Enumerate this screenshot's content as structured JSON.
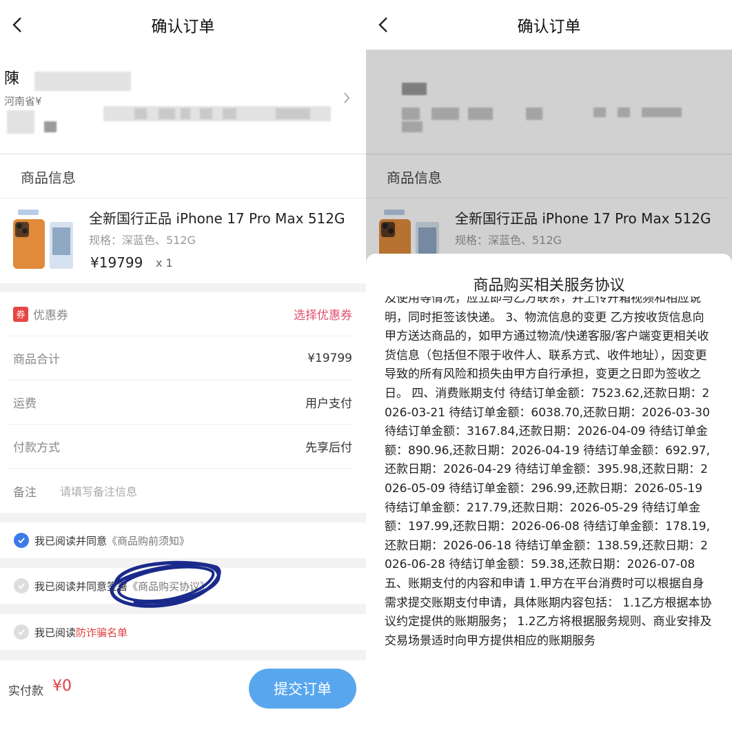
{
  "header": {
    "title": "确认订单",
    "back_icon": "chevron-left-icon"
  },
  "address": {
    "name": "陳",
    "region": "河南省¥"
  },
  "product_section": {
    "title": "商品信息"
  },
  "product": {
    "name": "全新国行正品 iPhone 17 Pro Max 512G",
    "spec": "规格：深蓝色、512G",
    "price": "¥19799",
    "qty": "x 1"
  },
  "order_rows": {
    "coupon": {
      "tag": "券",
      "label": "优惠券",
      "value": "选择优惠券"
    },
    "subtotal": {
      "label": "商品合计",
      "value": "¥19799"
    },
    "shipping": {
      "label": "运费",
      "value": "用户支付"
    },
    "payment": {
      "label": "付款方式",
      "value": "先享后付"
    },
    "remark": {
      "label": "备注",
      "placeholder": "请填写备注信息"
    }
  },
  "agreements": [
    {
      "prefix": "我已阅读并同意",
      "link": "《商品购前须知》",
      "checked": true
    },
    {
      "prefix": "我已阅读并同意签署",
      "link": "《商品购买协议》",
      "checked": false
    },
    {
      "prefix": "我已阅读",
      "link": "防诈骗名单",
      "checked": false
    }
  ],
  "bottom_bar": {
    "pay_label": "实付款",
    "pay_value": "¥0",
    "submit": "提交订单"
  },
  "sheet": {
    "title": "商品购买相关服务协议",
    "text": "及使用等情况，应立即与乙方联系，并上传开箱视频和相应说明，同时拒签该快递。 3、物流信息的变更 乙方按收货信息向甲方送达商品的，如甲方通过物流/快递客服/客户端变更相关收货信息（包括但不限于收件人、联系方式、收件地址），因变更导致的所有风险和损失由甲方自行承担，变更之日即为签收之日。 四、消费账期支付 待结订单金额：7523.62,还款日期：2026-03-21 待结订单金额：6038.70,还款日期：2026-03-30 待结订单金额：3167.84,还款日期：2026-04-09 待结订单金额：890.96,还款日期：2026-04-19 待结订单金额：692.97,还款日期：2026-04-29 待结订单金额：395.98,还款日期：2026-05-09 待结订单金额：296.99,还款日期：2026-05-19 待结订单金额：217.79,还款日期：2026-05-29 待结订单金额：197.99,还款日期：2026-06-08 待结订单金额：178.19,还款日期：2026-06-18 待结订单金额：138.59,还款日期：2026-06-28 待结订单金额：59.38,还款日期：2026-07-08 五、账期支付的内容和申请 1.甲方在平台消费时可以根据自身需求提交账期支付申请，具体账期内容包括： 1.1乙方根据本协议约定提供的账期服务； 1.2乙方将根据服务规则、商业安排及交易场景适时向甲方提供相应的账期服务"
  },
  "colors": {
    "accent": "#58a7ee",
    "check": "#3a7be8",
    "red": "#e04040",
    "scribble": "#1a2a8c"
  }
}
